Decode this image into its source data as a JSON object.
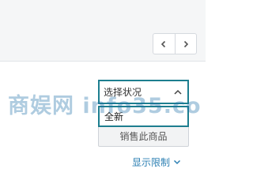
{
  "pagination": {
    "prev_icon": "chevron-left-icon",
    "next_icon": "chevron-right-icon"
  },
  "condition_select": {
    "placeholder": "选择状况",
    "caret_icon": "chevron-up-icon",
    "open_option": "全新"
  },
  "sell_button": {
    "label": "销售此商品"
  },
  "show_limits": {
    "label": "显示限制",
    "icon": "chevron-down-icon"
  },
  "watermark": {
    "text": "商娱网 info35.co"
  },
  "colors": {
    "accent": "#1d7e8f",
    "link": "#2b7fb3",
    "top_bar_bg": "#f5f6f7"
  }
}
